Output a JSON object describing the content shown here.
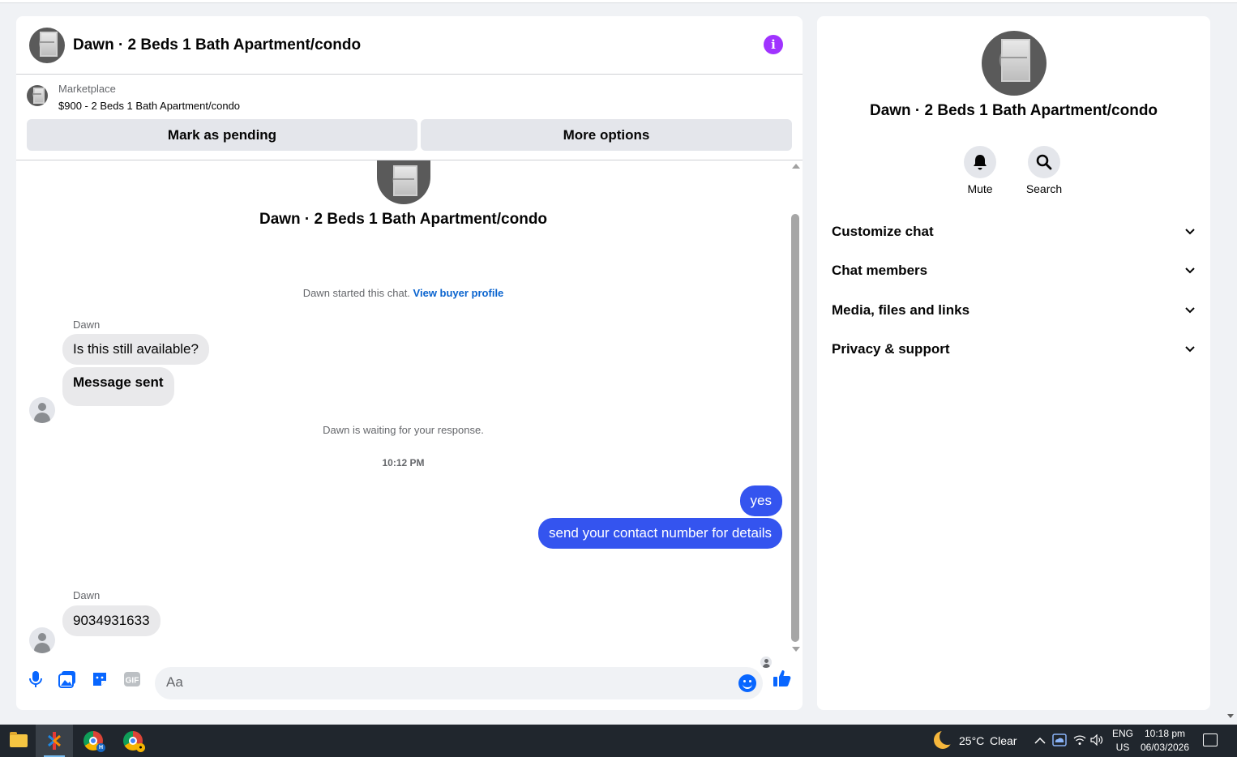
{
  "colors": {
    "accent": "#0866ff",
    "outgoing_bubble": "#3454ef",
    "info_button": "#a033ff",
    "link": "#0a64cf"
  },
  "header": {
    "title": "Dawn · 2 Beds 1 Bath Apartment/condo",
    "info_icon": "info-icon"
  },
  "listing": {
    "label": "Marketplace",
    "price_title": "$900 - 2 Beds 1 Bath Apartment/condo",
    "pending_button": "Mark as pending",
    "more_button": "More options"
  },
  "conversation": {
    "title": "Dawn · 2 Beds 1 Bath Apartment/condo",
    "started_text": "Dawn started this chat.",
    "buyer_profile_link": "View buyer profile",
    "waiting_text": "Dawn is waiting for your response.",
    "timestamp": "10:12 PM",
    "group1": {
      "sender": "Dawn",
      "messages": [
        "Is this still available?",
        "Message sent"
      ]
    },
    "outgoing": [
      "yes",
      "send your contact number for details"
    ],
    "group2": {
      "sender": "Dawn",
      "messages": [
        "9034931633"
      ]
    }
  },
  "composer": {
    "placeholder": "Aa",
    "icons": [
      "microphone-icon",
      "photo-icon",
      "sticker-icon",
      "gif-icon",
      "emoji-icon",
      "like-icon"
    ],
    "gif_label": "GIF"
  },
  "panel": {
    "title": "Dawn · 2 Beds 1 Bath Apartment/condo",
    "actions": [
      {
        "label": "Mute",
        "icon": "bell-icon"
      },
      {
        "label": "Search",
        "icon": "search-icon"
      }
    ],
    "sections": [
      {
        "label": "Customize chat"
      },
      {
        "label": "Chat members"
      },
      {
        "label": "Media, files and links"
      },
      {
        "label": "Privacy & support"
      }
    ]
  },
  "taskbar": {
    "apps": [
      "file-explorer-icon",
      "app-icon",
      "chrome-icon",
      "chrome-icon"
    ],
    "weather_temp": "25°C",
    "weather_desc": "Clear",
    "lang": "ENG",
    "region": "US",
    "time": "10:18 pm",
    "date": "06/03/2026"
  }
}
